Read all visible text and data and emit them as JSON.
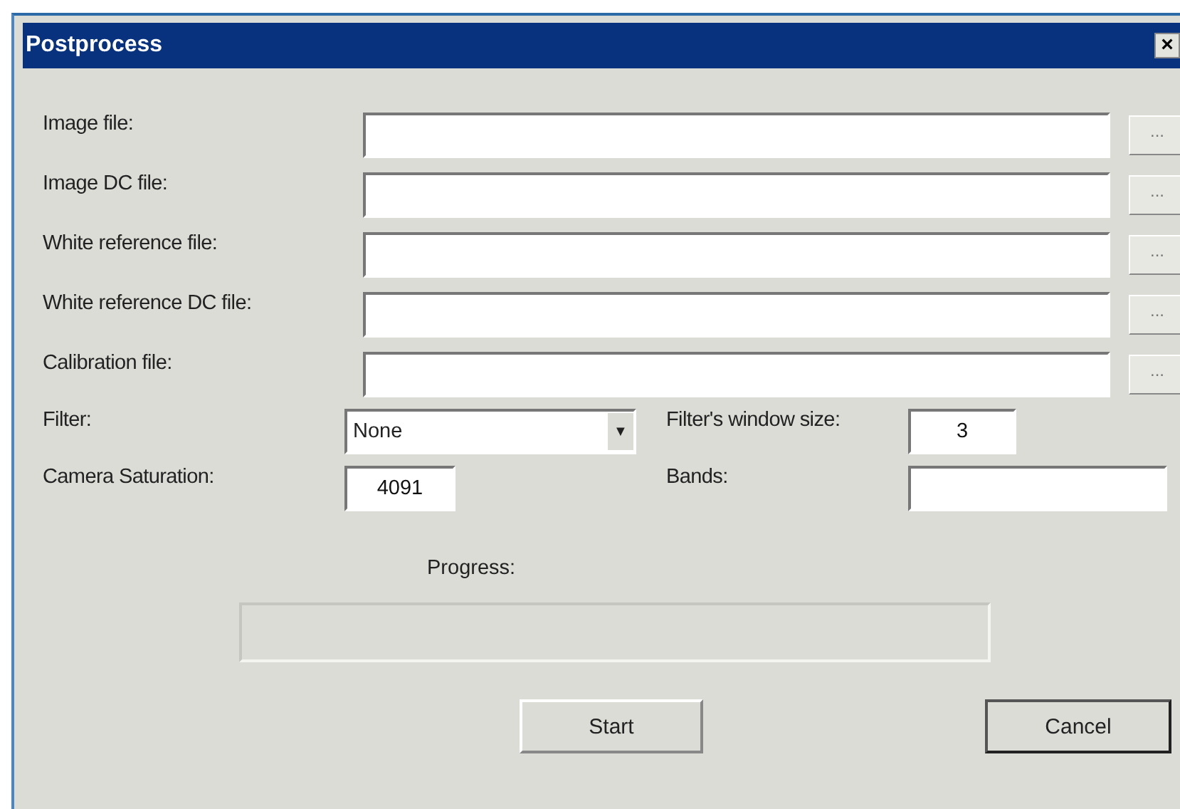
{
  "window": {
    "title": "Postprocess",
    "close": "×"
  },
  "file_rows": [
    {
      "label": "Image file:",
      "browse": "..."
    },
    {
      "label": "Image DC file:",
      "browse": "..."
    },
    {
      "label": "White reference file:",
      "browse": "..."
    },
    {
      "label": "White reference DC file:",
      "browse": "..."
    },
    {
      "label": "Calibration file:",
      "browse": "..."
    }
  ],
  "filter": {
    "label": "Filter:",
    "value": "None",
    "arrow": "▼"
  },
  "filter_window_size": {
    "label": "Filter's window size:",
    "value": "3"
  },
  "camera_saturation": {
    "label": "Camera Saturation:",
    "value": "4091"
  },
  "bands": {
    "label": "Bands:"
  },
  "progress": {
    "label": "Progress:"
  },
  "buttons": [
    {
      "label": "Start",
      "default": false
    },
    {
      "label": "Cancel",
      "default": true
    }
  ]
}
